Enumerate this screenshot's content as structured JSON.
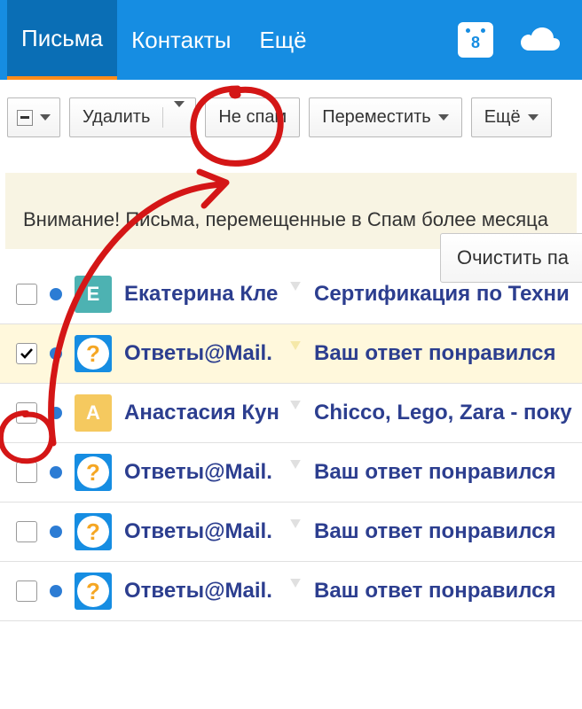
{
  "nav": {
    "mail": "Письма",
    "contacts": "Контакты",
    "more": "Ещё",
    "calendar_day": "8"
  },
  "toolbar": {
    "delete": "Удалить",
    "not_spam": "Не спам",
    "move": "Переместить",
    "more": "Ещё"
  },
  "info": {
    "clear_button": "Очистить па",
    "warning": "Внимание! Письма, перемещенные в Спам более месяца"
  },
  "emails": [
    {
      "sender": "Екатерина Кле",
      "subject": "Сертификация по Техни",
      "avatar": "E",
      "avatar_type": "e",
      "selected": false
    },
    {
      "sender": "Ответы@Mail.",
      "subject": "Ваш ответ понравился",
      "avatar": "?",
      "avatar_type": "q",
      "selected": true
    },
    {
      "sender": "Анастасия Кун",
      "subject": "Chicco, Lego, Zara - поку",
      "avatar": "A",
      "avatar_type": "a",
      "selected": false
    },
    {
      "sender": "Ответы@Mail.",
      "subject": "Ваш ответ понравился",
      "avatar": "?",
      "avatar_type": "q",
      "selected": false
    },
    {
      "sender": "Ответы@Mail.",
      "subject": "Ваш ответ понравился",
      "avatar": "?",
      "avatar_type": "q",
      "selected": false
    },
    {
      "sender": "Ответы@Mail.",
      "subject": "Ваш ответ понравился",
      "avatar": "?",
      "avatar_type": "q",
      "selected": false
    }
  ]
}
